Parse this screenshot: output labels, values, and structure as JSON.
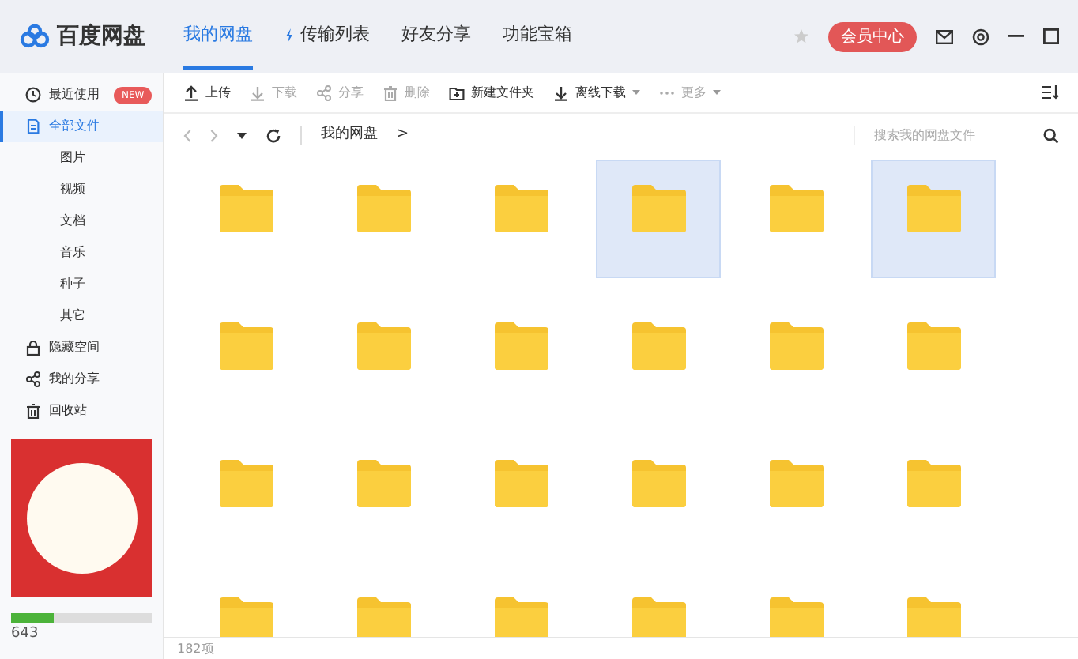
{
  "app": {
    "name": "百度网盘"
  },
  "nav_tabs": [
    {
      "label": "我的网盘",
      "selected": true
    },
    {
      "label": "传输列表",
      "selected": false
    },
    {
      "label": "好友分享",
      "selected": false
    },
    {
      "label": "功能宝箱",
      "selected": false
    }
  ],
  "vip_button": "会员中心",
  "toolbar": [
    {
      "label": "上传",
      "kind": "upload",
      "disabled": false,
      "dropdown": false
    },
    {
      "label": "下载",
      "kind": "download",
      "disabled": true,
      "dropdown": false
    },
    {
      "label": "分享",
      "kind": "share",
      "disabled": true,
      "dropdown": false
    },
    {
      "label": "删除",
      "kind": "trash",
      "disabled": true,
      "dropdown": false
    },
    {
      "label": "新建文件夹",
      "kind": "newfolder",
      "disabled": false,
      "dropdown": false
    },
    {
      "label": "离线下载",
      "kind": "download",
      "disabled": false,
      "dropdown": true
    },
    {
      "label": "更多",
      "kind": "more",
      "disabled": true,
      "dropdown": true
    }
  ],
  "breadcrumb": {
    "path": "我的网盘",
    "separator": ">"
  },
  "search": {
    "placeholder": "搜索我的网盘文件"
  },
  "sidebar": {
    "items": [
      {
        "label": "最近使用",
        "kind": "recent",
        "badge": "NEW",
        "selected": false
      },
      {
        "label": "全部文件",
        "kind": "files",
        "selected": true,
        "children": [
          {
            "label": "图片",
            "selected": false
          },
          {
            "label": "视频",
            "selected": false
          },
          {
            "label": "文档",
            "selected": false
          },
          {
            "label": "音乐",
            "selected": false
          },
          {
            "label": "种子",
            "selected": false
          },
          {
            "label": "其它",
            "selected": false
          }
        ]
      },
      {
        "label": "隐藏空间",
        "kind": "hidden",
        "selected": false
      },
      {
        "label": "我的分享",
        "kind": "share",
        "selected": false
      },
      {
        "label": "回收站",
        "kind": "trash",
        "selected": false
      }
    ]
  },
  "storage": {
    "level": 0.3,
    "text": "643"
  },
  "folders": [
    {
      "selected": false
    },
    {
      "selected": false
    },
    {
      "selected": false
    },
    {
      "selected": true
    },
    {
      "selected": false
    },
    {
      "selected": true
    },
    {
      "selected": false
    },
    {
      "selected": false
    },
    {
      "selected": false
    },
    {
      "selected": false
    },
    {
      "selected": false
    },
    {
      "selected": false
    },
    {
      "selected": false
    },
    {
      "selected": false
    },
    {
      "selected": false
    },
    {
      "selected": false
    },
    {
      "selected": false
    },
    {
      "selected": false
    },
    {
      "selected": false
    },
    {
      "selected": false
    },
    {
      "selected": false
    },
    {
      "selected": false
    },
    {
      "selected": false
    },
    {
      "selected": false
    }
  ],
  "status_bar": {
    "count": "182项"
  }
}
